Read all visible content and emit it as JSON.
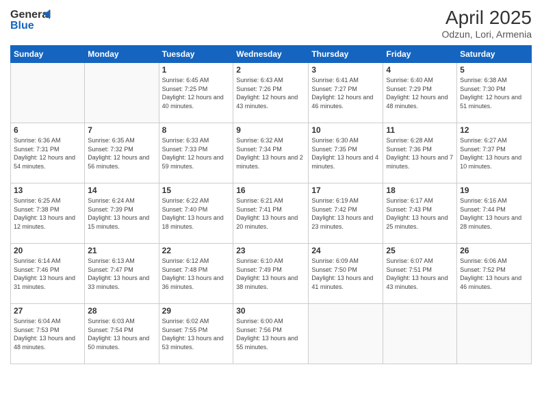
{
  "logo": {
    "line1": "General",
    "line2": "Blue"
  },
  "title": "April 2025",
  "subtitle": "Odzun, Lori, Armenia",
  "weekdays": [
    "Sunday",
    "Monday",
    "Tuesday",
    "Wednesday",
    "Thursday",
    "Friday",
    "Saturday"
  ],
  "weeks": [
    [
      {
        "day": "",
        "sunrise": "",
        "sunset": "",
        "daylight": ""
      },
      {
        "day": "",
        "sunrise": "",
        "sunset": "",
        "daylight": ""
      },
      {
        "day": "1",
        "sunrise": "Sunrise: 6:45 AM",
        "sunset": "Sunset: 7:25 PM",
        "daylight": "Daylight: 12 hours and 40 minutes."
      },
      {
        "day": "2",
        "sunrise": "Sunrise: 6:43 AM",
        "sunset": "Sunset: 7:26 PM",
        "daylight": "Daylight: 12 hours and 43 minutes."
      },
      {
        "day": "3",
        "sunrise": "Sunrise: 6:41 AM",
        "sunset": "Sunset: 7:27 PM",
        "daylight": "Daylight: 12 hours and 46 minutes."
      },
      {
        "day": "4",
        "sunrise": "Sunrise: 6:40 AM",
        "sunset": "Sunset: 7:29 PM",
        "daylight": "Daylight: 12 hours and 48 minutes."
      },
      {
        "day": "5",
        "sunrise": "Sunrise: 6:38 AM",
        "sunset": "Sunset: 7:30 PM",
        "daylight": "Daylight: 12 hours and 51 minutes."
      }
    ],
    [
      {
        "day": "6",
        "sunrise": "Sunrise: 6:36 AM",
        "sunset": "Sunset: 7:31 PM",
        "daylight": "Daylight: 12 hours and 54 minutes."
      },
      {
        "day": "7",
        "sunrise": "Sunrise: 6:35 AM",
        "sunset": "Sunset: 7:32 PM",
        "daylight": "Daylight: 12 hours and 56 minutes."
      },
      {
        "day": "8",
        "sunrise": "Sunrise: 6:33 AM",
        "sunset": "Sunset: 7:33 PM",
        "daylight": "Daylight: 12 hours and 59 minutes."
      },
      {
        "day": "9",
        "sunrise": "Sunrise: 6:32 AM",
        "sunset": "Sunset: 7:34 PM",
        "daylight": "Daylight: 13 hours and 2 minutes."
      },
      {
        "day": "10",
        "sunrise": "Sunrise: 6:30 AM",
        "sunset": "Sunset: 7:35 PM",
        "daylight": "Daylight: 13 hours and 4 minutes."
      },
      {
        "day": "11",
        "sunrise": "Sunrise: 6:28 AM",
        "sunset": "Sunset: 7:36 PM",
        "daylight": "Daylight: 13 hours and 7 minutes."
      },
      {
        "day": "12",
        "sunrise": "Sunrise: 6:27 AM",
        "sunset": "Sunset: 7:37 PM",
        "daylight": "Daylight: 13 hours and 10 minutes."
      }
    ],
    [
      {
        "day": "13",
        "sunrise": "Sunrise: 6:25 AM",
        "sunset": "Sunset: 7:38 PM",
        "daylight": "Daylight: 13 hours and 12 minutes."
      },
      {
        "day": "14",
        "sunrise": "Sunrise: 6:24 AM",
        "sunset": "Sunset: 7:39 PM",
        "daylight": "Daylight: 13 hours and 15 minutes."
      },
      {
        "day": "15",
        "sunrise": "Sunrise: 6:22 AM",
        "sunset": "Sunset: 7:40 PM",
        "daylight": "Daylight: 13 hours and 18 minutes."
      },
      {
        "day": "16",
        "sunrise": "Sunrise: 6:21 AM",
        "sunset": "Sunset: 7:41 PM",
        "daylight": "Daylight: 13 hours and 20 minutes."
      },
      {
        "day": "17",
        "sunrise": "Sunrise: 6:19 AM",
        "sunset": "Sunset: 7:42 PM",
        "daylight": "Daylight: 13 hours and 23 minutes."
      },
      {
        "day": "18",
        "sunrise": "Sunrise: 6:17 AM",
        "sunset": "Sunset: 7:43 PM",
        "daylight": "Daylight: 13 hours and 25 minutes."
      },
      {
        "day": "19",
        "sunrise": "Sunrise: 6:16 AM",
        "sunset": "Sunset: 7:44 PM",
        "daylight": "Daylight: 13 hours and 28 minutes."
      }
    ],
    [
      {
        "day": "20",
        "sunrise": "Sunrise: 6:14 AM",
        "sunset": "Sunset: 7:46 PM",
        "daylight": "Daylight: 13 hours and 31 minutes."
      },
      {
        "day": "21",
        "sunrise": "Sunrise: 6:13 AM",
        "sunset": "Sunset: 7:47 PM",
        "daylight": "Daylight: 13 hours and 33 minutes."
      },
      {
        "day": "22",
        "sunrise": "Sunrise: 6:12 AM",
        "sunset": "Sunset: 7:48 PM",
        "daylight": "Daylight: 13 hours and 36 minutes."
      },
      {
        "day": "23",
        "sunrise": "Sunrise: 6:10 AM",
        "sunset": "Sunset: 7:49 PM",
        "daylight": "Daylight: 13 hours and 38 minutes."
      },
      {
        "day": "24",
        "sunrise": "Sunrise: 6:09 AM",
        "sunset": "Sunset: 7:50 PM",
        "daylight": "Daylight: 13 hours and 41 minutes."
      },
      {
        "day": "25",
        "sunrise": "Sunrise: 6:07 AM",
        "sunset": "Sunset: 7:51 PM",
        "daylight": "Daylight: 13 hours and 43 minutes."
      },
      {
        "day": "26",
        "sunrise": "Sunrise: 6:06 AM",
        "sunset": "Sunset: 7:52 PM",
        "daylight": "Daylight: 13 hours and 46 minutes."
      }
    ],
    [
      {
        "day": "27",
        "sunrise": "Sunrise: 6:04 AM",
        "sunset": "Sunset: 7:53 PM",
        "daylight": "Daylight: 13 hours and 48 minutes."
      },
      {
        "day": "28",
        "sunrise": "Sunrise: 6:03 AM",
        "sunset": "Sunset: 7:54 PM",
        "daylight": "Daylight: 13 hours and 50 minutes."
      },
      {
        "day": "29",
        "sunrise": "Sunrise: 6:02 AM",
        "sunset": "Sunset: 7:55 PM",
        "daylight": "Daylight: 13 hours and 53 minutes."
      },
      {
        "day": "30",
        "sunrise": "Sunrise: 6:00 AM",
        "sunset": "Sunset: 7:56 PM",
        "daylight": "Daylight: 13 hours and 55 minutes."
      },
      {
        "day": "",
        "sunrise": "",
        "sunset": "",
        "daylight": ""
      },
      {
        "day": "",
        "sunrise": "",
        "sunset": "",
        "daylight": ""
      },
      {
        "day": "",
        "sunrise": "",
        "sunset": "",
        "daylight": ""
      }
    ]
  ]
}
